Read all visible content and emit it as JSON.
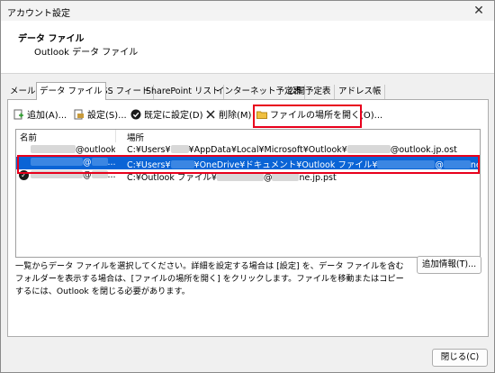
{
  "window": {
    "title": "アカウント設定",
    "close_glyph": "✕"
  },
  "header": {
    "title": "データ ファイル",
    "subtitle": "Outlook データ ファイル"
  },
  "tabs": [
    {
      "label": "メール"
    },
    {
      "label": "データ ファイル",
      "active": true
    },
    {
      "label": "RSS フィード"
    },
    {
      "label": "SharePoint リスト"
    },
    {
      "label": "インターネット予定表"
    },
    {
      "label": "公開予定表"
    },
    {
      "label": "アドレス帳"
    }
  ],
  "toolbar": {
    "add": "追加(A)...",
    "settings": "設定(S)...",
    "set_default": "既定に設定(D)",
    "delete": "削除(M)",
    "open_location": "ファイルの場所を開く(O)..."
  },
  "list": {
    "col_name": "名前",
    "col_location": "場所",
    "rows": [
      {
        "name_prefix": "",
        "name_suffix": "@outlook.jp",
        "loc_a": "C:¥Users¥",
        "loc_b": "¥AppData¥Local¥Microsoft¥Outlook¥",
        "loc_c": "@outlook.jp.ost",
        "selected": false,
        "default": false
      },
      {
        "name_prefix": "",
        "name_suffix": "@",
        "name_tail": "...",
        "loc_a": "C:¥Users¥",
        "loc_b": "¥OneDrive¥ドキュメント¥Outlook ファイル¥",
        "loc_c": "@",
        "loc_d": "ne.jp.pst",
        "selected": true,
        "default": false
      },
      {
        "name_prefix": "",
        "name_suffix": "@",
        "name_tail": "...",
        "loc_a": "C:¥Outlook ファイル¥",
        "loc_b": "",
        "loc_c": "@",
        "loc_d": "ne.jp.pst",
        "selected": false,
        "default": true
      }
    ]
  },
  "description": "一覧からデータ ファイルを選択してください。詳細を設定する場合は [設定] を、データ ファイルを含むフォルダーを表示する場合は、[ファイルの場所を開く] をクリックします。ファイルを移動またはコピーするには、Outlook を閉じる必要があります。",
  "buttons": {
    "more_info": "追加情報(T)...",
    "close": "閉じる(C)"
  }
}
